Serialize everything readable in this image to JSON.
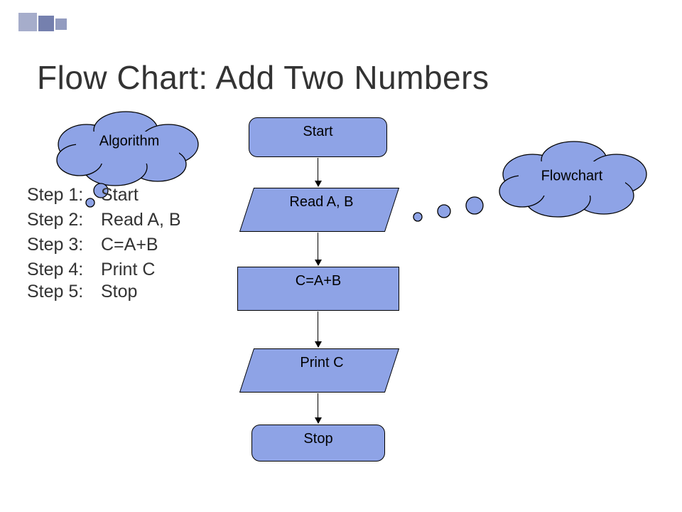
{
  "title": "Flow Chart: Add Two Numbers",
  "clouds": {
    "algorithm": "Algorithm",
    "flowchart": "Flowchart"
  },
  "steps": [
    {
      "label": "Step 1:",
      "text": "Start"
    },
    {
      "label": "Step 2:",
      "text": "Read A, B"
    },
    {
      "label": "Step 3:",
      "text": "C=A+B"
    },
    {
      "label": "Step 4:",
      "text": "Print C"
    },
    {
      "label": "Step 5:",
      "text": "Stop"
    }
  ],
  "flow": {
    "start": "Start",
    "read": "Read A, B",
    "process": "C=A+B",
    "print": "Print C",
    "stop": "Stop"
  }
}
